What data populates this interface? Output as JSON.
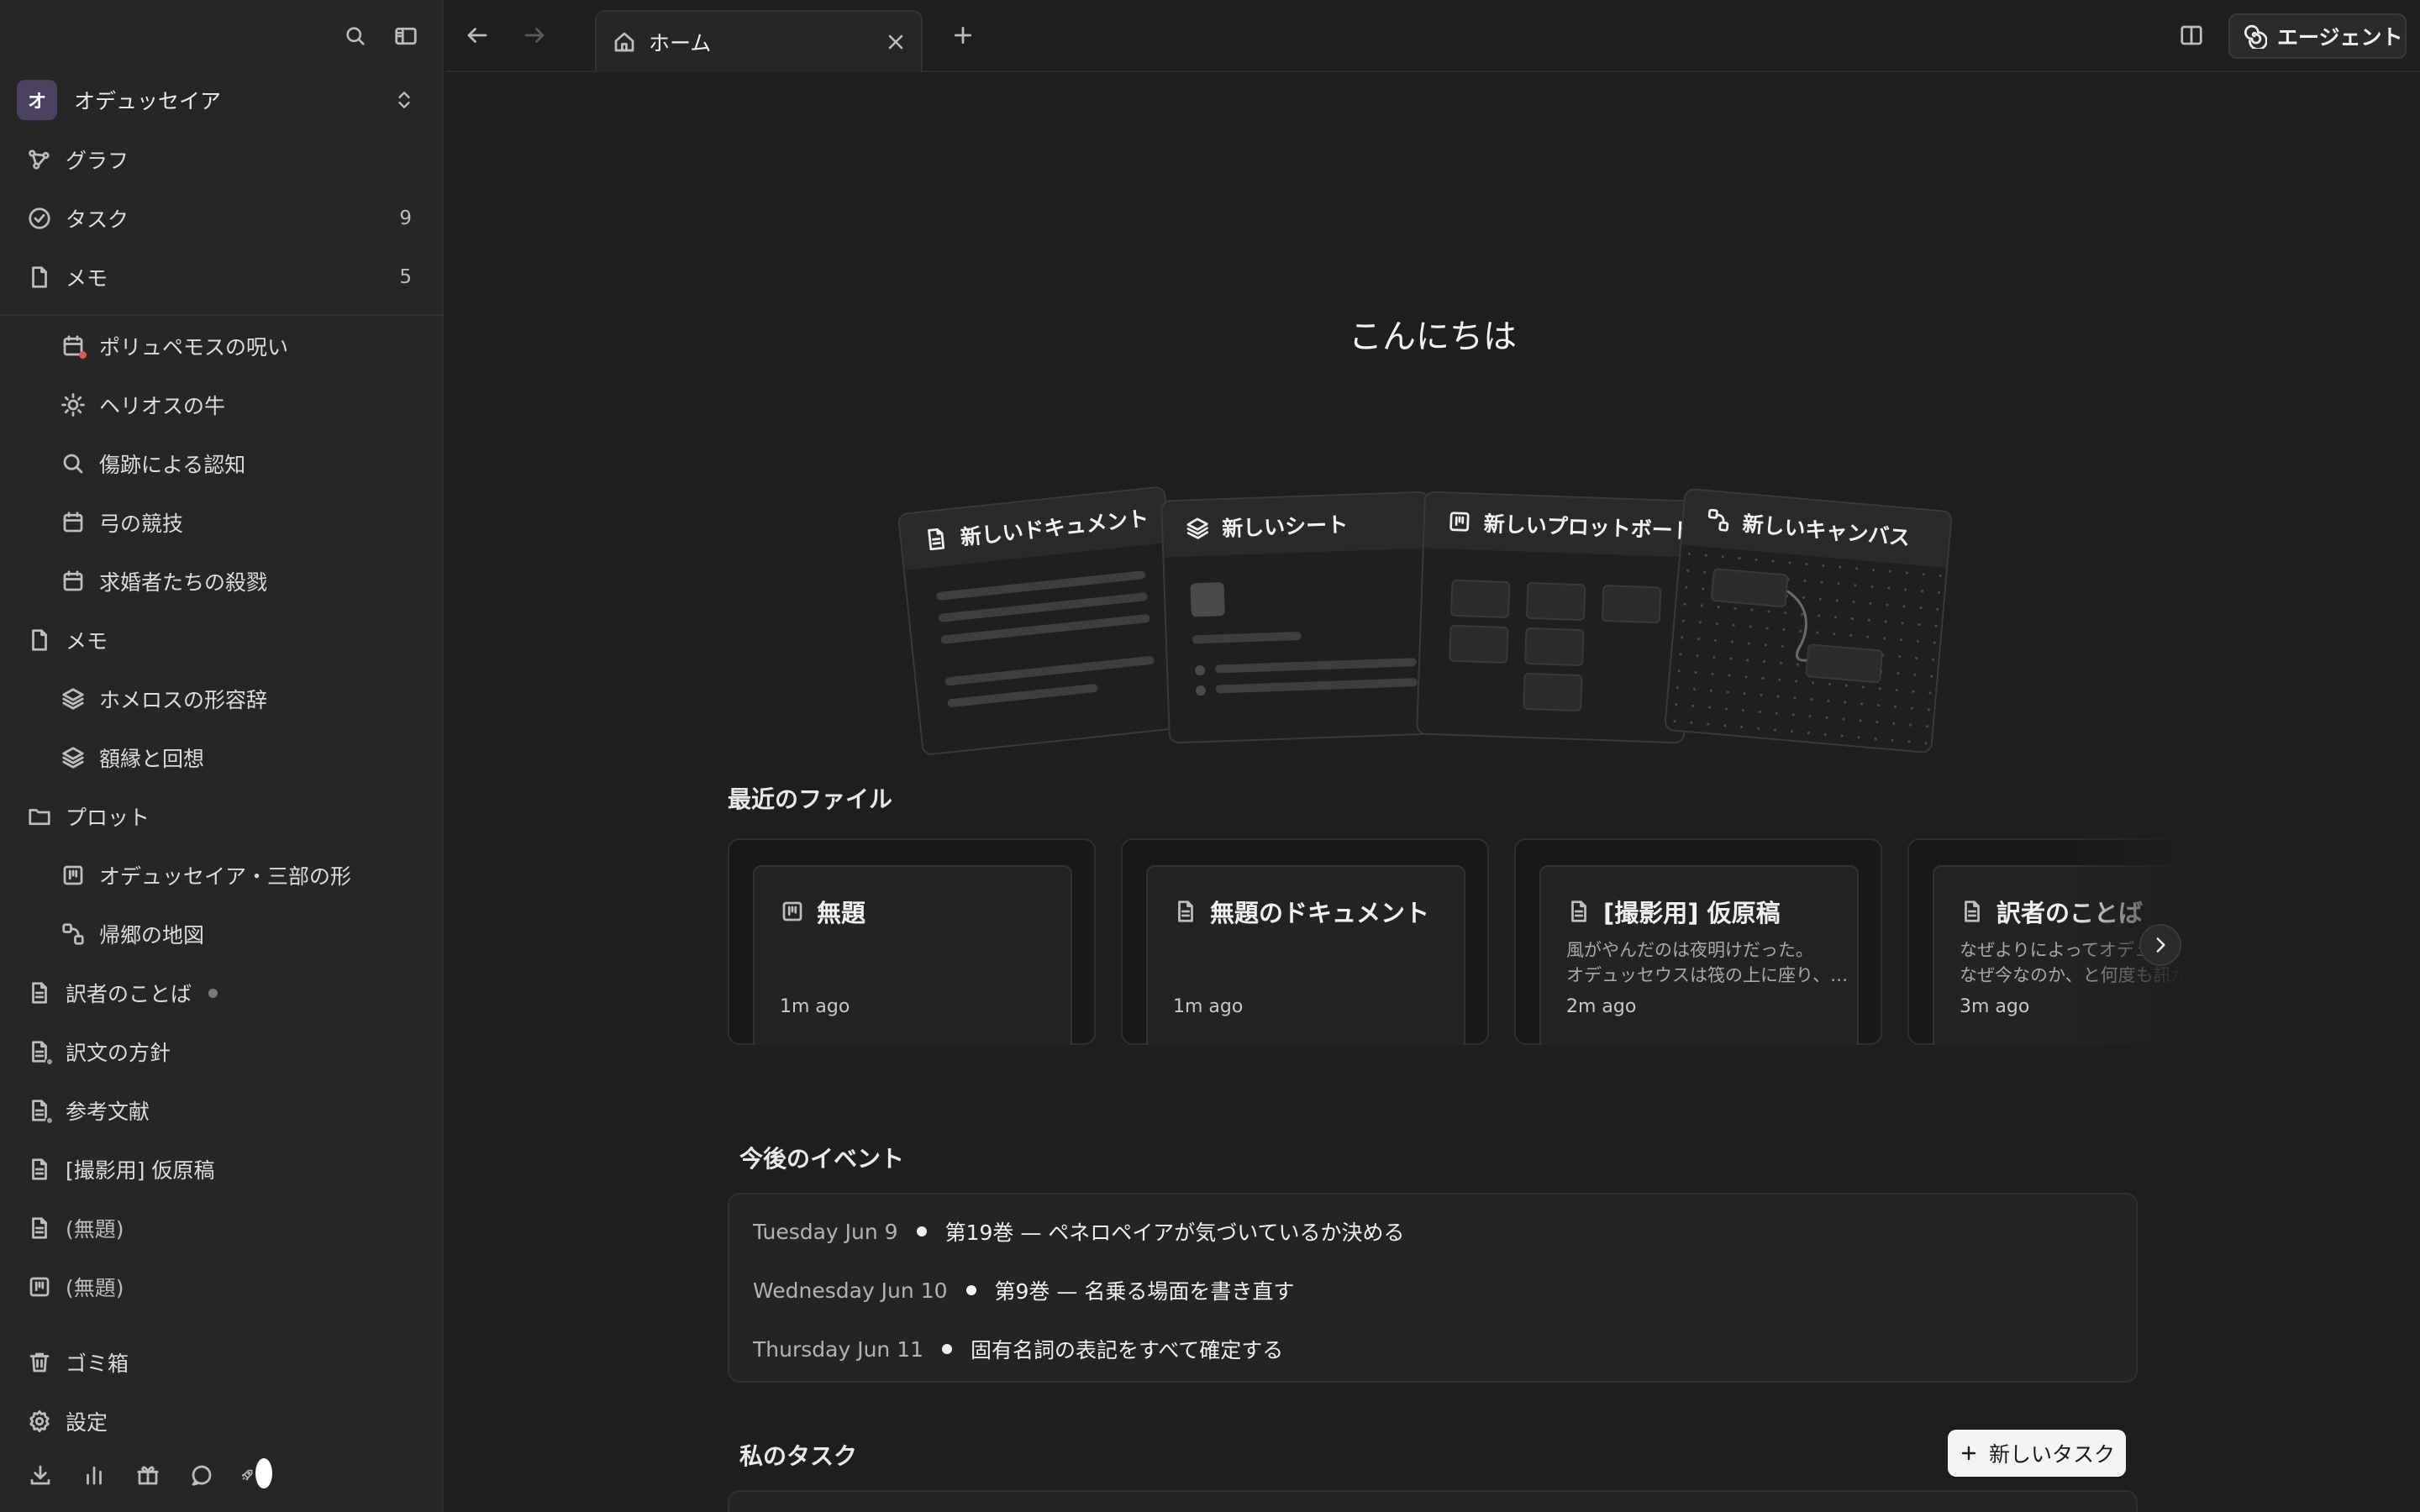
{
  "sidebar": {
    "workspace": {
      "initial": "オ",
      "name": "オデュッセイア"
    },
    "nav": [
      {
        "label": "グラフ",
        "icon": "graph-icon",
        "count": ""
      },
      {
        "label": "タスク",
        "icon": "check-circle-icon",
        "count": "9"
      },
      {
        "label": "メモ",
        "icon": "note-icon",
        "count": "5"
      }
    ],
    "items": [
      {
        "label": "ポリュペモスの呪い",
        "icon": "calendar-icon"
      },
      {
        "label": "ヘリオスの牛",
        "icon": "sun-icon"
      },
      {
        "label": "傷跡による認知",
        "icon": "search-icon"
      },
      {
        "label": "弓の競技",
        "icon": "calendar-icon"
      },
      {
        "label": "求婚者たちの殺戮",
        "icon": "calendar-icon"
      },
      {
        "label": "メモ",
        "icon": "note-icon"
      },
      {
        "label": "ホメロスの形容辞",
        "icon": "layers-icon"
      },
      {
        "label": "額縁と回想",
        "icon": "layers-icon"
      },
      {
        "label": "プロット",
        "icon": "folder-icon"
      },
      {
        "label": "オデュッセイア・三部の形",
        "icon": "board-icon"
      },
      {
        "label": "帰郷の地図",
        "icon": "canvas-icon"
      },
      {
        "label": "訳者のことば",
        "icon": "document-icon"
      },
      {
        "label": "訳文の方針",
        "icon": "document-icon"
      },
      {
        "label": "参考文献",
        "icon": "document-icon"
      },
      {
        "label": "[撮影用] 仮原稿",
        "icon": "document-icon"
      },
      {
        "label": "(無題)",
        "icon": "document-icon"
      },
      {
        "label": "(無題)",
        "icon": "board-icon"
      }
    ],
    "footer": [
      {
        "label": "ゴミ箱",
        "icon": "trash-icon"
      },
      {
        "label": "設定",
        "icon": "gear-icon"
      }
    ]
  },
  "topbar": {
    "tab_label": "ホーム",
    "agent_label": "エージェント"
  },
  "main": {
    "greeting": "こんにちは",
    "quick_create": [
      {
        "label": "新しいドキュメント",
        "icon": "document-icon"
      },
      {
        "label": "新しいシート",
        "icon": "layers-icon"
      },
      {
        "label": "新しいプロットボード",
        "icon": "board-icon"
      },
      {
        "label": "新しいキャンバス",
        "icon": "canvas-icon"
      }
    ],
    "recent_title": "最近のファイル",
    "recent": [
      {
        "title": "無題",
        "icon": "board-icon",
        "snippet1": "",
        "snippet2": "",
        "time": "1m ago"
      },
      {
        "title": "無題のドキュメント",
        "icon": "document-icon",
        "snippet1": "",
        "snippet2": "",
        "time": "1m ago"
      },
      {
        "title": "[撮影用] 仮原稿",
        "icon": "document-icon",
        "snippet1": "風がやんだのは夜明けだった。",
        "snippet2": "オデュッセウスは筏の上に座り、…",
        "time": "2m ago"
      },
      {
        "title": "訳者のことば",
        "icon": "document-icon",
        "snippet1": "なぜよりによってオデュ",
        "snippet2": "なぜ今なのか、と何度も訊かれ",
        "time": "3m ago"
      }
    ],
    "events_title": "今後のイベント",
    "events": [
      {
        "date": "Tuesday Jun 9",
        "title": "第19巻 — ペネロペイアが気づいているか決める"
      },
      {
        "date": "Wednesday Jun 10",
        "title": "第9巻 — 名乗る場面を書き直す"
      },
      {
        "date": "Thursday Jun 11",
        "title": "固有名詞の表記をすべて確定する"
      }
    ],
    "tasks_title": "私のタスク",
    "new_task_label": "新しいタスク"
  }
}
